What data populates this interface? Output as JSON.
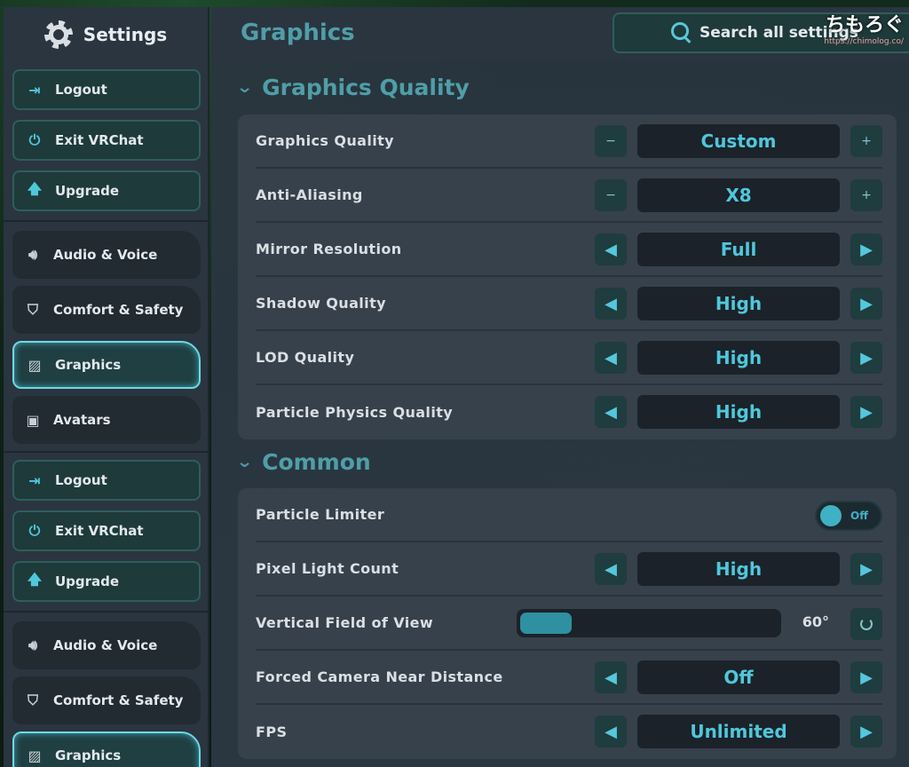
{
  "sidebar": {
    "title": "Settings",
    "groups": [
      {
        "buttons": [
          {
            "label": "Logout",
            "icon": "logout-icon"
          },
          {
            "label": "Exit VRChat",
            "icon": "power-icon"
          },
          {
            "label": "Upgrade",
            "icon": "arrow-up-icon"
          }
        ]
      },
      {
        "tabs": [
          {
            "label": "Audio & Voice",
            "icon": "speaker-icon"
          },
          {
            "label": "Comfort & Safety",
            "icon": "shield-icon"
          },
          {
            "label": "Graphics",
            "icon": "image-icon",
            "active": true
          },
          {
            "label": "Avatars",
            "icon": "avatar-icon"
          }
        ]
      },
      {
        "buttons": [
          {
            "label": "Logout",
            "icon": "logout-icon"
          },
          {
            "label": "Exit VRChat",
            "icon": "power-icon"
          },
          {
            "label": "Upgrade",
            "icon": "arrow-up-icon"
          }
        ]
      },
      {
        "tabs": [
          {
            "label": "Audio & Voice",
            "icon": "speaker-icon"
          },
          {
            "label": "Comfort & Safety",
            "icon": "shield-icon"
          },
          {
            "label": "Graphics",
            "icon": "image-icon",
            "active": true
          }
        ]
      }
    ]
  },
  "header": {
    "title": "Graphics",
    "search_label": "Search all settings"
  },
  "watermark": {
    "main": "ちもろぐ",
    "sub": "https://chimolog.co/"
  },
  "sections": [
    {
      "title": "Graphics Quality",
      "rows": [
        {
          "label": "Graphics Quality",
          "type": "stepper",
          "value": "Custom"
        },
        {
          "label": "Anti-Aliasing",
          "type": "stepper",
          "value": "X8"
        },
        {
          "label": "Mirror Resolution",
          "type": "selector",
          "value": "Full"
        },
        {
          "label": "Shadow Quality",
          "type": "selector",
          "value": "High"
        },
        {
          "label": "LOD Quality",
          "type": "selector",
          "value": "High"
        },
        {
          "label": "Particle Physics Quality",
          "type": "selector",
          "value": "High"
        }
      ]
    },
    {
      "title": "Common",
      "rows": [
        {
          "label": "Particle Limiter",
          "type": "toggle",
          "value": "Off",
          "state": false
        },
        {
          "label": "Pixel Light Count",
          "type": "selector",
          "value": "High"
        },
        {
          "label": "Vertical Field of View",
          "type": "slider",
          "value": "60°",
          "fraction": 0.2
        },
        {
          "label": "Forced Camera Near Distance",
          "type": "selector",
          "value": "Off"
        },
        {
          "label": "FPS",
          "type": "selector",
          "value": "Unlimited"
        }
      ]
    }
  ],
  "glyphs": {
    "minus": "−",
    "plus": "+",
    "left": "◀",
    "right": "▶",
    "chevron": "⌄"
  },
  "colors": {
    "accent": "#4fc7db",
    "panel": "#37414b",
    "sidebar": "#2a3540"
  }
}
